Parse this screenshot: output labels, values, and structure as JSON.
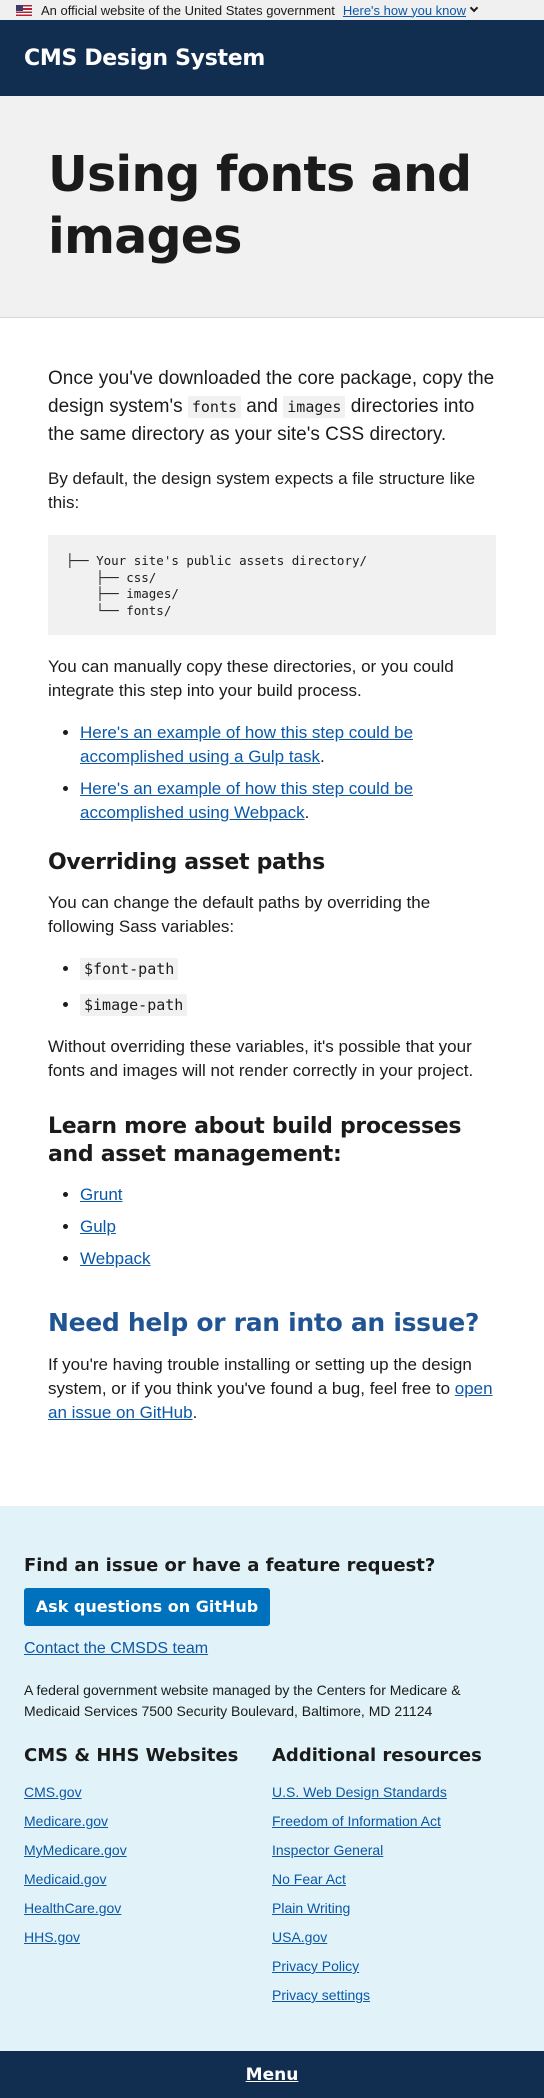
{
  "banner": {
    "text": "An official website of the United States government",
    "link": "Here's how you know"
  },
  "header": {
    "title": "CMS Design System"
  },
  "hero": {
    "title": "Using fonts and images"
  },
  "main": {
    "lead_part1": "Once you've downloaded the core package, copy the design system's ",
    "lead_code1": "fonts",
    "lead_and": " and ",
    "lead_code2": "images",
    "lead_part2": " directories into the same directory as your site's CSS directory.",
    "p_default": "By default, the design system expects a file structure like this:",
    "code_block": "├── Your site's public assets directory/\n    ├── css/\n    ├── images/\n    └── fonts/",
    "p_copy": "You can manually copy these directories, or you could integrate this step into your build process.",
    "example_links": [
      "Here's an example of how this step could be accomplished using a Gulp task",
      "Here's an example of how this step could be accomplished using Webpack"
    ],
    "h_override": "Overriding asset paths",
    "p_override": "You can change the default paths by overriding the following Sass variables:",
    "sass_vars": [
      "$font-path",
      "$image-path"
    ],
    "p_without": "Without overriding these variables, it's possible that your fonts and images will not render correctly in your project.",
    "h_learn": "Learn more about build processes and asset management:",
    "learn_links": [
      "Grunt",
      "Gulp",
      "Webpack"
    ],
    "h_help": "Need help or ran into an issue?",
    "p_help": "If you're having trouble installing or setting up the design system, or if you think you've found a bug, feel free to ",
    "help_link": "open an issue on GitHub",
    "p_help_end": "."
  },
  "footer": {
    "ask_heading": "Find an issue or have a feature request?",
    "ask_button": "Ask questions on GitHub",
    "contact_link": "Contact the CMSDS team",
    "federal_text": "A federal government website managed by the Centers for Medicare & Medicaid Services 7500 Security Boulevard, Baltimore, MD 21124",
    "col1_heading": "CMS & HHS Websites",
    "col1_links": [
      "CMS.gov",
      "Medicare.gov",
      "MyMedicare.gov",
      "Medicaid.gov",
      "HealthCare.gov",
      "HHS.gov"
    ],
    "col2_heading": "Additional resources",
    "col2_links": [
      "U.S. Web Design Standards",
      "Freedom of Information Act",
      "Inspector General",
      "No Fear Act",
      "Plain Writing",
      "USA.gov",
      "Privacy Policy",
      "Privacy settings"
    ]
  },
  "menu": {
    "label": "Menu"
  }
}
